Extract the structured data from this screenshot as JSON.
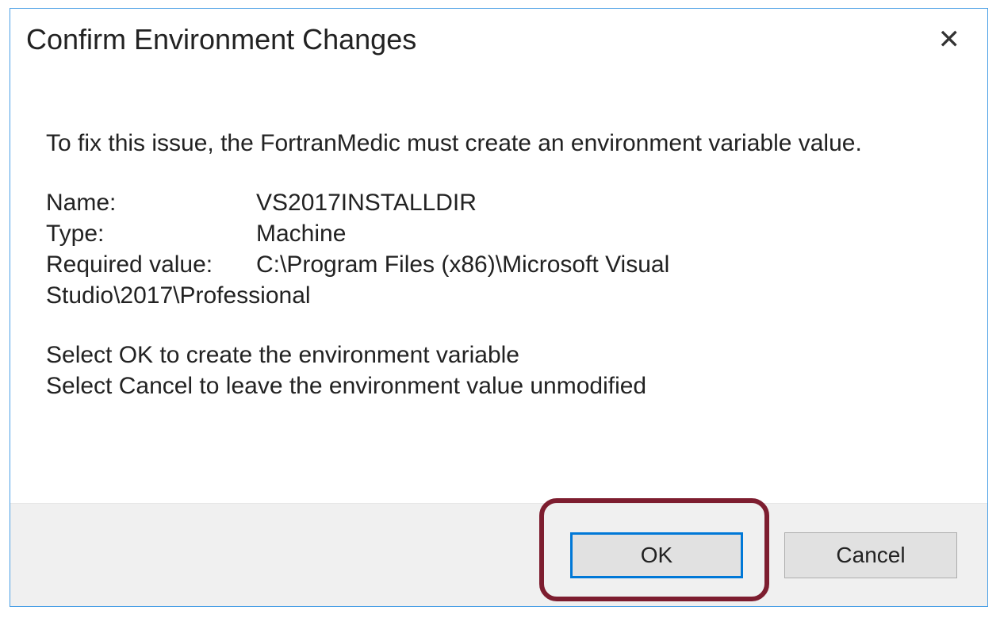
{
  "title": "Confirm Environment Changes",
  "intro": "To fix this issue, the FortranMedic must create an environment variable value.",
  "fields": {
    "name_label": "Name:",
    "name_value": "VS2017INSTALLDIR",
    "type_label": "Type:",
    "type_value": "Machine",
    "req_label": "Required value:",
    "req_value_line1": "C:\\Program Files (x86)\\Microsoft Visual",
    "req_value_line2": "Studio\\2017\\Professional"
  },
  "instructions": {
    "ok_line": "Select OK to create the environment variable",
    "cancel_line": "Select Cancel to leave the environment value unmodified"
  },
  "buttons": {
    "ok": "OK",
    "cancel": "Cancel"
  },
  "highlight": {
    "target": "ok-button",
    "color": "#7d1d2f"
  }
}
